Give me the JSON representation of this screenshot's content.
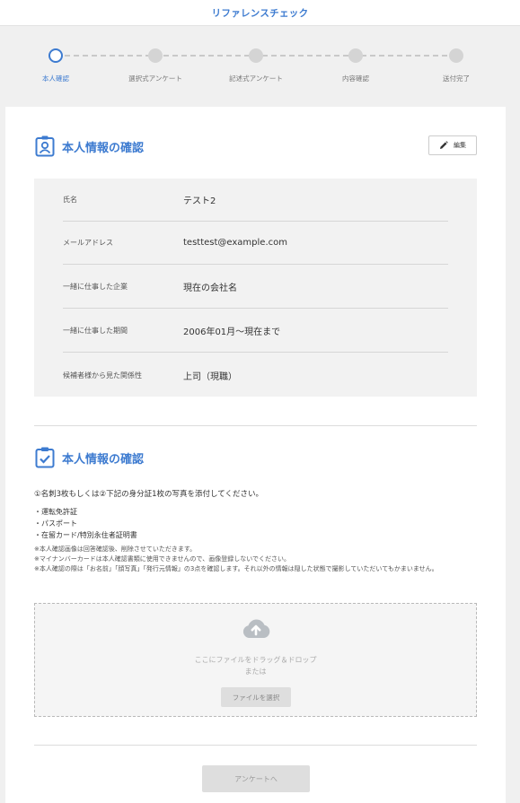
{
  "header": {
    "logo": "リファレンスチェック"
  },
  "steps": [
    {
      "label": "本人確認",
      "active": true
    },
    {
      "label": "選択式アンケート",
      "active": false
    },
    {
      "label": "記述式アンケート",
      "active": false
    },
    {
      "label": "内容確認",
      "active": false
    },
    {
      "label": "送付完了",
      "active": false
    }
  ],
  "section1": {
    "title": "本人情報の確認",
    "edit_label": "編集",
    "rows": [
      {
        "label": "氏名",
        "value": "テスト2"
      },
      {
        "label": "メールアドレス",
        "value": "testtest@example.com"
      },
      {
        "label": "一緒に仕事した企業",
        "value": "現在の会社名"
      },
      {
        "label": "一緒に仕事した期間",
        "value": "2006年01月～現在まで"
      },
      {
        "label": "候補者様から見た関係性",
        "value": "上司（現職）"
      }
    ]
  },
  "section2": {
    "title": "本人情報の確認",
    "instruction": "①名刺3枚もしくは②下記の身分証1枚の写真を添付してください。",
    "id_list": [
      "・運転免許証",
      "・パスポート",
      "・在留カード/特別永住者証明書"
    ],
    "notes": [
      "※本人確認画像は回答確認後、削除させていただきます。",
      "※マイナンバーカードは本人確認書類に使用できませんので、画像登録しないでください。",
      "※本人確認の際は「お名前」「顔写真」「発行元情報」の3点を確認します。それ以外の情報は隠した状態で撮影していただいてもかまいません。"
    ],
    "dropzone_text": "ここにファイルをドラッグ＆ドロップ",
    "dropzone_or": "または",
    "file_button": "ファイルを選択"
  },
  "submit_label": "アンケートへ",
  "colors": {
    "accent": "#3d7bd0",
    "disabled": "#dedede"
  }
}
